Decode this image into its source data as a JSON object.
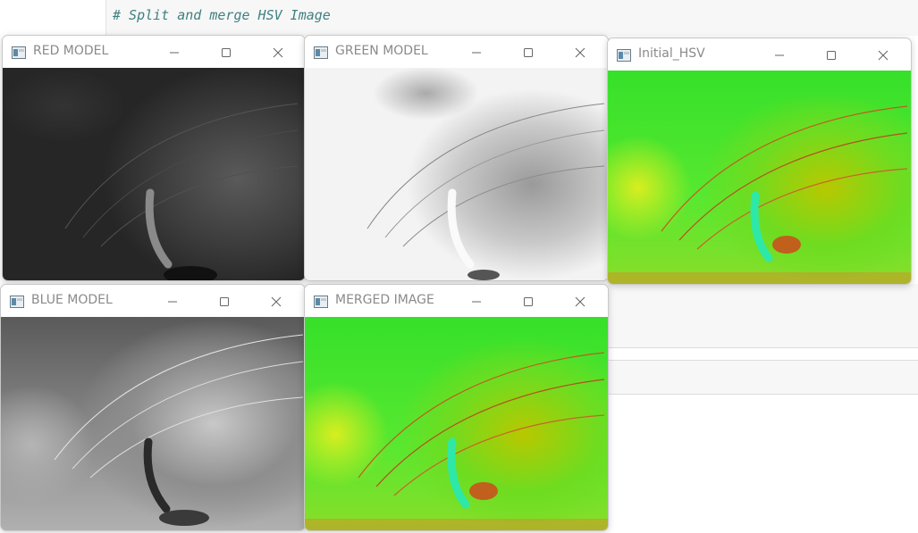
{
  "code": {
    "comment_line": "# Split and merge HSV Image"
  },
  "windows": {
    "red": {
      "title": "RED MODEL"
    },
    "green": {
      "title": "GREEN MODEL"
    },
    "hsv": {
      "title": "Initial_HSV"
    },
    "blue": {
      "title": "BLUE MODEL"
    },
    "merged": {
      "title": "MERGED IMAGE"
    }
  },
  "icons": {
    "minimize": "minimize-icon",
    "maximize": "maximize-icon",
    "close": "close-icon",
    "app": "opencv-window-icon"
  },
  "colors": {
    "code_comment": "#3f7f7f",
    "title_text": "#8a8a8a"
  }
}
